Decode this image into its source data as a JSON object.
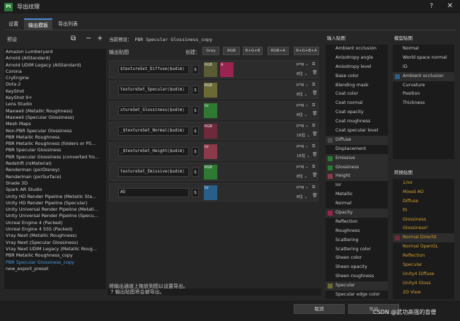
{
  "window": {
    "title": "导出纹理",
    "help": "?",
    "close": "✕",
    "logo": "Pt"
  },
  "tabs": [
    "设置",
    "输出模板",
    "导出列表"
  ],
  "presets": {
    "label": "预设",
    "items": [
      "Amazon Lumberyard",
      "Arnold (AiStandard)",
      "Arnold UDIM Legacy (AiStandard)",
      "Corona",
      "CryEngine",
      "Dota 2",
      "KeyShot",
      "KeyShot 9+",
      "Lens Studio",
      "Maxwell (Metallic Roughness)",
      "Maxwell (Specular Glossiness)",
      "Mesh Maps",
      "Non-PBR Specular Glossiness",
      "PBR Metallic Roughness",
      "PBR Metallic Roughness (folders or PS...",
      "PBR Specular Glossiness",
      "PBR Specular Glossiness (converted fro...",
      "Redshift (rsMaterial)",
      "Renderman (pxrDisney)",
      "Renderman (pxrSurface)",
      "Shade 3D",
      "Spark AR Studio",
      "Unity HD Render Pipeline (Metallic Sta...",
      "Unity HD Render Pipeline (Specular)",
      "Unity Universal Render Pipeline (Metall...",
      "Unity Universal Render Pipeline (Specu...",
      "Unreal Engine 4 (Packed)",
      "Unreal Engine 4 SSS (Packed)",
      "Vray Next (Metallic Roughness)",
      "Vray Next (Specular Glossiness)",
      "Vray Next UDIM Legacy (Metallic Roug...",
      "PBR Metallic Roughness_copy",
      "PBR Specular Glossiness_copy",
      "new_export_preset"
    ],
    "selected_index": 32
  },
  "output": {
    "current_preset": "当前预设： PBR Specular Glossiness_copy",
    "maps_label": "输出贴图",
    "create_label": "创建：",
    "create_buttons": [
      "Gray",
      "RGB",
      "R+G+B",
      "RGB+A",
      "R+G+B+A"
    ],
    "rows": [
      {
        "name": "$textureSet_Diffuse($udim)",
        "dollar": "$",
        "ch1": "RGB",
        "ch1c": "#5a5a34",
        "ch2": "A",
        "ch2c": "#9b2350",
        "fmt": "png ⌄",
        "bits": "8位 ⌄"
      },
      {
        "name": "textureSet_Specular($udim)",
        "dollar": "$",
        "ch1": "RGB",
        "ch1c": "#6b6a35",
        "ch2": "",
        "ch2c": "",
        "fmt": "png ⌄",
        "bits": "8位 ⌄"
      },
      {
        "name": "xtureSet_Glossiness($udim)",
        "dollar": "$",
        "ch1": "Gr",
        "ch1c": "#2f7a32",
        "ch2": "",
        "ch2c": "",
        "fmt": "png ⌄",
        "bits": "8位 ⌄"
      },
      {
        "name": "_$textureSet_Normal($udim)",
        "dollar": "$",
        "ch1": "RGB",
        "ch1c": "#6e2a3a",
        "ch2": "",
        "ch2c": "",
        "fmt": "png ⌄",
        "bits": "16位 ⌄"
      },
      {
        "name": "_$textureSet_Height($udim)",
        "dollar": "$",
        "ch1": "Gr",
        "ch1c": "#8a3a48",
        "ch2": "",
        "ch2c": "",
        "fmt": "png ⌄",
        "bits": "16位 ⌄"
      },
      {
        "name": "textureSet_Emissive($udim)",
        "dollar": "$",
        "ch1": "RGB",
        "ch1c": "#2f7a32",
        "ch2": "",
        "ch2c": "",
        "fmt": "png ⌄",
        "bits": "8位 ⌄"
      },
      {
        "name": "AO",
        "dollar": "$",
        "ch1": "Gr",
        "ch1c": "#2a5f8a",
        "ch2": "",
        "ch2c": "",
        "fmt": "png ⌄",
        "bits": "8位 ⌄"
      }
    ],
    "drag_hint": "将输出通道上拖放到图以设置导出。",
    "info": "7 输出贴图将会被导出。"
  },
  "input_maps": {
    "label": "输入贴图",
    "items": [
      {
        "t": "Ambient occlusion",
        "c": ""
      },
      {
        "t": "Anisotropy angle",
        "c": ""
      },
      {
        "t": "Anisotropy level",
        "c": ""
      },
      {
        "t": "Base color",
        "c": ""
      },
      {
        "t": "Blending mask",
        "c": ""
      },
      {
        "t": "Coat color",
        "c": ""
      },
      {
        "t": "Coat normal",
        "c": ""
      },
      {
        "t": "Coat opacity",
        "c": ""
      },
      {
        "t": "Coat roughness",
        "c": ""
      },
      {
        "t": "Coat specular level",
        "c": ""
      },
      {
        "t": "Diffuse",
        "c": "#4a4a4a"
      },
      {
        "t": "Displacement",
        "c": ""
      },
      {
        "t": "Emissive",
        "c": "#2f7a32"
      },
      {
        "t": "Glossiness",
        "c": "#2f7a32"
      },
      {
        "t": "Height",
        "c": "#8a3a48"
      },
      {
        "t": "Ior",
        "c": ""
      },
      {
        "t": "Metallic",
        "c": ""
      },
      {
        "t": "Normal",
        "c": ""
      },
      {
        "t": "Opacity",
        "c": "#9b2350"
      },
      {
        "t": "Reflection",
        "c": ""
      },
      {
        "t": "Roughness",
        "c": ""
      },
      {
        "t": "Scattering",
        "c": ""
      },
      {
        "t": "Scattering color",
        "c": ""
      },
      {
        "t": "Sheen color",
        "c": ""
      },
      {
        "t": "Sheen opacity",
        "c": ""
      },
      {
        "t": "Sheen roughness",
        "c": ""
      },
      {
        "t": "Specular",
        "c": "#6b6a35"
      },
      {
        "t": "Specular edge color",
        "c": ""
      }
    ]
  },
  "mesh_maps": {
    "label": "模型贴图",
    "items": [
      {
        "t": "Normal",
        "c": ""
      },
      {
        "t": "World space normal",
        "c": ""
      },
      {
        "t": "ID",
        "c": ""
      },
      {
        "t": "Ambient occlusion",
        "c": "#2a5f8a"
      },
      {
        "t": "Curvature",
        "c": ""
      },
      {
        "t": "Position",
        "c": ""
      },
      {
        "t": "Thickness",
        "c": ""
      }
    ]
  },
  "converted_maps": {
    "label": "转换贴图",
    "items": [
      {
        "t": "1/ior",
        "c": ""
      },
      {
        "t": "Mixed AO",
        "c": ""
      },
      {
        "t": "Diffuse",
        "c": ""
      },
      {
        "t": "f0",
        "c": ""
      },
      {
        "t": "Glossiness",
        "c": ""
      },
      {
        "t": "Glossiness²",
        "c": ""
      },
      {
        "t": "Normal DirectX",
        "c": "#6e2a3a"
      },
      {
        "t": "Normal OpenGL",
        "c": ""
      },
      {
        "t": "Reflection",
        "c": ""
      },
      {
        "t": "Specular",
        "c": ""
      },
      {
        "t": "Unity4 Diffuse",
        "c": ""
      },
      {
        "t": "Unity4 Gloss",
        "c": ""
      },
      {
        "t": "2D View",
        "c": ""
      }
    ]
  },
  "footer": {
    "cancel": "取消",
    "export": "导出",
    "watermark": "CSDN @武功高强的盲僧"
  }
}
